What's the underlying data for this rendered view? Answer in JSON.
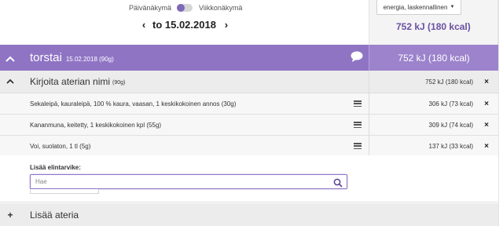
{
  "view_toggle": {
    "day_label": "Päivänäkymä",
    "week_label": "Viikkonäkymä"
  },
  "date_nav": {
    "prev_arrow": "‹",
    "date_text": "to 15.02.2018",
    "next_arrow": "›"
  },
  "metric_select": {
    "label": "energia, laskennallinen",
    "caret": "▼"
  },
  "top_total": "752 kJ (180 kcal)",
  "day": {
    "collapse_icon": "^",
    "name": "torstai",
    "meta": "15.02.2018 (90g)",
    "total": "752 kJ (180 kcal)",
    "comment_icon": "speech-bubble"
  },
  "meal": {
    "collapse_icon": "^",
    "name": "Kirjoita aterian nimi",
    "meta": "(90g)",
    "energy": "752 kJ (180 kcal)",
    "remove": "×"
  },
  "foods": [
    {
      "name": "Sekaleipä, kauraleipä, 100 % kaura, vaasan, 1 keskikokoinen annos (30g)",
      "energy": "306 kJ (73 kcal)",
      "remove": "×"
    },
    {
      "name": "Kananmuna, keitetty, 1 keskikokoinen kpl (55g)",
      "energy": "309 kJ (74 kcal)",
      "remove": "×"
    },
    {
      "name": "Voi, suolaton, 1 tl (5g)",
      "energy": "137 kJ (33 kcal)",
      "remove": "×"
    }
  ],
  "add_food": {
    "label": "Lisää elintarvike:",
    "placeholder": "Hae"
  },
  "add_meal": {
    "plus": "+",
    "label": "Lisää ateria"
  },
  "colors": {
    "accent": "#8f74c4",
    "accent_dark": "#6b4fa3"
  }
}
